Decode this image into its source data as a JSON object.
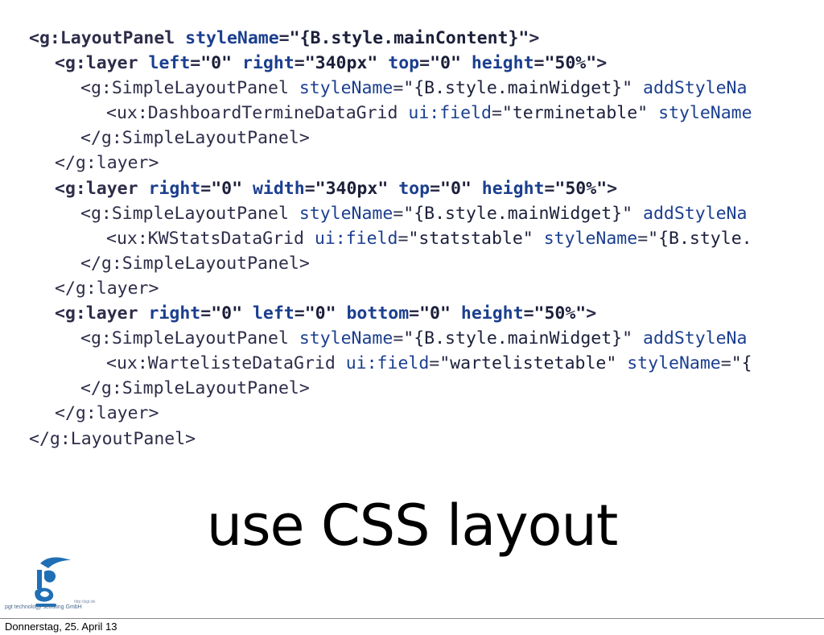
{
  "code_lines": [
    {
      "indent": 0,
      "bold": true,
      "parts": [
        [
          "tag",
          "<g:LayoutPanel "
        ],
        [
          "attr",
          "styleName"
        ],
        [
          "eq",
          "="
        ],
        [
          "val",
          "\"{B.style.mainContent}\""
        ],
        [
          "tag",
          ">"
        ]
      ]
    },
    {
      "indent": 1,
      "bold": true,
      "parts": [
        [
          "tag",
          "<g:layer "
        ],
        [
          "attr",
          "left"
        ],
        [
          "eq",
          "="
        ],
        [
          "val",
          "\"0\" "
        ],
        [
          "attr",
          "right"
        ],
        [
          "eq",
          "="
        ],
        [
          "val",
          "\"340px\" "
        ],
        [
          "attr",
          "top"
        ],
        [
          "eq",
          "="
        ],
        [
          "val",
          "\"0\" "
        ],
        [
          "attr",
          "height"
        ],
        [
          "eq",
          "="
        ],
        [
          "val",
          "\"50%\""
        ],
        [
          "tag",
          ">"
        ]
      ]
    },
    {
      "indent": 2,
      "bold": false,
      "parts": [
        [
          "tag",
          "<g:SimpleLayoutPanel "
        ],
        [
          "attr",
          "styleName"
        ],
        [
          "eq",
          "="
        ],
        [
          "val",
          "\"{B.style.mainWidget}\" "
        ],
        [
          "attr",
          "addStyleNa"
        ]
      ]
    },
    {
      "indent": 3,
      "bold": false,
      "parts": [
        [
          "tag",
          "<ux:DashboardTermineDataGrid "
        ],
        [
          "attr",
          "ui:field"
        ],
        [
          "eq",
          "="
        ],
        [
          "val",
          "\"terminetable\" "
        ],
        [
          "attr",
          "styleName"
        ]
      ]
    },
    {
      "indent": 2,
      "bold": false,
      "parts": [
        [
          "tag",
          "</g:SimpleLayoutPanel>"
        ]
      ]
    },
    {
      "indent": 1,
      "bold": false,
      "parts": [
        [
          "tag",
          "</g:layer>"
        ]
      ]
    },
    {
      "indent": 1,
      "bold": true,
      "parts": [
        [
          "tag",
          "<g:layer "
        ],
        [
          "attr",
          "right"
        ],
        [
          "eq",
          "="
        ],
        [
          "val",
          "\"0\" "
        ],
        [
          "attr",
          "width"
        ],
        [
          "eq",
          "="
        ],
        [
          "val",
          "\"340px\" "
        ],
        [
          "attr",
          "top"
        ],
        [
          "eq",
          "="
        ],
        [
          "val",
          "\"0\" "
        ],
        [
          "attr",
          "height"
        ],
        [
          "eq",
          "="
        ],
        [
          "val",
          "\"50%\""
        ],
        [
          "tag",
          ">"
        ]
      ]
    },
    {
      "indent": 2,
      "bold": false,
      "parts": [
        [
          "tag",
          "<g:SimpleLayoutPanel "
        ],
        [
          "attr",
          "styleName"
        ],
        [
          "eq",
          "="
        ],
        [
          "val",
          "\"{B.style.mainWidget}\" "
        ],
        [
          "attr",
          "addStyleNa"
        ]
      ]
    },
    {
      "indent": 3,
      "bold": false,
      "parts": [
        [
          "tag",
          "<ux:KWStatsDataGrid "
        ],
        [
          "attr",
          "ui:field"
        ],
        [
          "eq",
          "="
        ],
        [
          "val",
          "\"statstable\" "
        ],
        [
          "attr",
          "styleName"
        ],
        [
          "eq",
          "="
        ],
        [
          "val",
          "\"{B.style."
        ]
      ]
    },
    {
      "indent": 2,
      "bold": false,
      "parts": [
        [
          "tag",
          "</g:SimpleLayoutPanel>"
        ]
      ]
    },
    {
      "indent": 1,
      "bold": false,
      "parts": [
        [
          "tag",
          "</g:layer>"
        ]
      ]
    },
    {
      "indent": 1,
      "bold": true,
      "parts": [
        [
          "tag",
          "<g:layer "
        ],
        [
          "attr",
          "right"
        ],
        [
          "eq",
          "="
        ],
        [
          "val",
          "\"0\" "
        ],
        [
          "attr",
          "left"
        ],
        [
          "eq",
          "="
        ],
        [
          "val",
          "\"0\" "
        ],
        [
          "attr",
          "bottom"
        ],
        [
          "eq",
          "="
        ],
        [
          "val",
          "\"0\" "
        ],
        [
          "attr",
          "height"
        ],
        [
          "eq",
          "="
        ],
        [
          "val",
          "\"50%\""
        ],
        [
          "tag",
          ">"
        ]
      ]
    },
    {
      "indent": 2,
      "bold": false,
      "parts": [
        [
          "tag",
          "<g:SimpleLayoutPanel "
        ],
        [
          "attr",
          "styleName"
        ],
        [
          "eq",
          "="
        ],
        [
          "val",
          "\"{B.style.mainWidget}\" "
        ],
        [
          "attr",
          "addStyleNa"
        ]
      ]
    },
    {
      "indent": 3,
      "bold": false,
      "parts": [
        [
          "tag",
          "<ux:WartelisteDataGrid "
        ],
        [
          "attr",
          "ui:field"
        ],
        [
          "eq",
          "="
        ],
        [
          "val",
          "\"wartelistetable\" "
        ],
        [
          "attr",
          "styleName"
        ],
        [
          "eq",
          "="
        ],
        [
          "val",
          "\"{"
        ]
      ]
    },
    {
      "indent": 2,
      "bold": false,
      "parts": [
        [
          "tag",
          "</g:SimpleLayoutPanel>"
        ]
      ]
    },
    {
      "indent": 1,
      "bold": false,
      "parts": [
        [
          "tag",
          "</g:layer>"
        ]
      ]
    },
    {
      "indent": 0,
      "bold": false,
      "parts": [
        [
          "tag",
          "</g:LayoutPanel>"
        ]
      ]
    }
  ],
  "slide_title": "use CSS layout",
  "logo": {
    "name": "pgt-logo-icon",
    "company": "pgt technology scouting GmbH",
    "url": "http://pgt.de",
    "color": "#1f6fb5"
  },
  "footer": {
    "date": "Donnerstag, 25. April 13"
  }
}
